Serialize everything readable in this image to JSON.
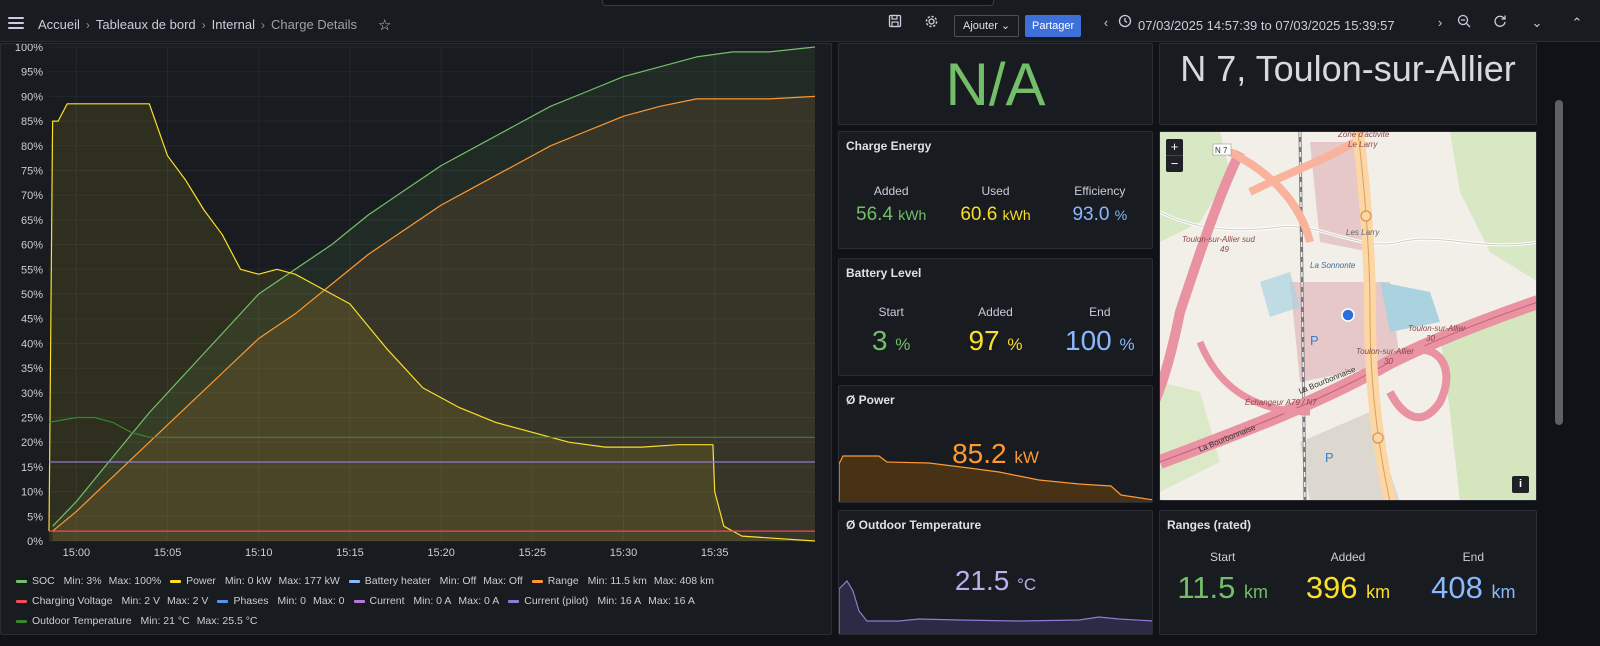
{
  "topbar": {
    "breadcrumbs": [
      "Accueil",
      "Tableaux de bord",
      "Internal",
      "Charge Details"
    ],
    "add_label": "Ajouter",
    "share_label": "Partager",
    "time_range": "07/03/2025 14:57:39 to 07/03/2025 15:39:57",
    "icons": [
      "menu-icon",
      "star-icon",
      "save-icon",
      "gear-icon",
      "chevron-down-icon",
      "chevron-left-icon",
      "clock-icon",
      "chevron-right-icon",
      "zoom-out-icon",
      "refresh-icon",
      "chevron-up-icon"
    ]
  },
  "status_panel": {
    "value": "N/A"
  },
  "address_panel": {
    "value": "N 7, Toulon-sur-Allier"
  },
  "charge_energy": {
    "title": "Charge Energy",
    "items": [
      {
        "label": "Added",
        "value": "56.4",
        "unit": "kWh"
      },
      {
        "label": "Used",
        "value": "60.6",
        "unit": "kWh"
      },
      {
        "label": "Efficiency",
        "value": "93.0",
        "unit": "%"
      }
    ]
  },
  "battery_level": {
    "title": "Battery Level",
    "items": [
      {
        "label": "Start",
        "value": "3",
        "unit": "%"
      },
      {
        "label": "Added",
        "value": "97",
        "unit": "%"
      },
      {
        "label": "End",
        "value": "100",
        "unit": "%"
      }
    ]
  },
  "avg_power": {
    "title": "Ø Power",
    "value": "85.2",
    "unit": "kW"
  },
  "avg_temp": {
    "title": "Ø Outdoor Temperature",
    "value": "21.5",
    "unit": "°C"
  },
  "ranges": {
    "title": "Ranges (rated)",
    "items": [
      {
        "label": "Start",
        "value": "11.5",
        "unit": "km"
      },
      {
        "label": "Added",
        "value": "396",
        "unit": "km"
      },
      {
        "label": "End",
        "value": "408",
        "unit": "km"
      }
    ]
  },
  "map": {
    "zoom_in": "+",
    "zoom_out": "−",
    "info": "i",
    "labels": [
      "N 7",
      "Zone d'activité\nLe Larry",
      "Les Larry",
      "Toulon-sur-Allier sud",
      "49",
      "La Sonnonte",
      "Toulon-sur-Allier",
      "30",
      "Échangeur A79 / N7",
      "La Bourbonnaise",
      "P"
    ],
    "colors": {
      "land": "#f2efe9",
      "urban": "#e6c8c8",
      "motorway": "#e892a2",
      "trunk": "#f9b29c",
      "primary": "#fcd6a4",
      "water": "#aad3df",
      "green": "#cde4b4",
      "marker": "#2a6fe0"
    }
  },
  "legend": [
    {
      "name": "SOC",
      "min": "Min: 3%",
      "max": "Max: 100%",
      "color": "#73bf69"
    },
    {
      "name": "Power",
      "min": "Min: 0 kW",
      "max": "Max: 177 kW",
      "color": "#fade2a"
    },
    {
      "name": "Battery heater",
      "min": "Min: Off",
      "max": "Max: Off",
      "color": "#8ab8ff"
    },
    {
      "name": "Range",
      "min": "Min: 11.5 km",
      "max": "Max: 408 km",
      "color": "#ff9830"
    },
    {
      "name": "Charging Voltage",
      "min": "Min: 2 V",
      "max": "Max: 2 V",
      "color": "#f2495c"
    },
    {
      "name": "Phases",
      "min": "Min: 0",
      "max": "Max: 0",
      "color": "#5794f2"
    },
    {
      "name": "Current",
      "min": "Min: 0 A",
      "max": "Max: 0 A",
      "color": "#b877d9"
    },
    {
      "name": "Current (pilot)",
      "min": "Min: 16 A",
      "max": "Max: 16 A",
      "color": "#8f7ad4"
    },
    {
      "name": "Outdoor Temperature",
      "min": "Min: 21 °C",
      "max": "Max: 25.5 °C",
      "color": "#37872d"
    }
  ],
  "chart_data": {
    "type": "line",
    "ylim": [
      0,
      100
    ],
    "y_ticks": [
      "0%",
      "5%",
      "10%",
      "15%",
      "20%",
      "25%",
      "30%",
      "35%",
      "40%",
      "45%",
      "50%",
      "55%",
      "60%",
      "65%",
      "70%",
      "75%",
      "80%",
      "85%",
      "90%",
      "95%",
      "100%"
    ],
    "x_ticks": [
      "15:00",
      "15:05",
      "15:10",
      "15:15",
      "15:20",
      "15:25",
      "15:30",
      "15:35"
    ],
    "x_range_min": [
      -1.5,
      40.5
    ],
    "grid": true,
    "series": [
      {
        "name": "SOC",
        "color": "#73bf69",
        "t": [
          -1.3,
          0,
          2,
          4,
          6,
          8,
          10,
          12,
          14,
          16,
          18,
          20,
          22,
          24,
          26,
          28,
          30,
          32,
          34,
          36,
          38,
          40.5
        ],
        "v": [
          3,
          8,
          17,
          26,
          34,
          42,
          50,
          55,
          60,
          66,
          71,
          76,
          80,
          84,
          88,
          91,
          94,
          96,
          98,
          99,
          99,
          100
        ]
      },
      {
        "name": "Power",
        "color": "#fade2a",
        "t": [
          -1.5,
          -1.3,
          -1.0,
          -0.5,
          0.5,
          2,
          3,
          4,
          5,
          6,
          7,
          8,
          9,
          10,
          11,
          12,
          13,
          14,
          15,
          17,
          19,
          21,
          23,
          25,
          27,
          29,
          31,
          33,
          34,
          34.9,
          35,
          35.5,
          36.5,
          40.5
        ],
        "v": [
          2,
          85,
          85,
          88.5,
          88.5,
          88.5,
          88.5,
          88.5,
          78,
          73,
          67,
          62,
          55,
          54,
          55,
          54,
          52,
          50,
          48,
          39,
          31,
          27,
          24,
          22,
          20,
          19,
          19,
          19.5,
          19.5,
          19.5,
          10,
          3,
          1,
          0
        ]
      },
      {
        "name": "Range",
        "color": "#ff9830",
        "t": [
          -1.3,
          0,
          2,
          4,
          6,
          8,
          10,
          12,
          14,
          16,
          18,
          20,
          22,
          24,
          26,
          28,
          30,
          32,
          34,
          36,
          38,
          40.5
        ],
        "v": [
          2,
          6,
          13,
          20,
          27,
          34,
          41,
          46,
          52,
          58,
          63,
          68,
          72,
          76,
          80,
          83,
          86,
          88,
          89.5,
          89.5,
          89.5,
          90
        ]
      },
      {
        "name": "Outdoor Temperature",
        "color": "#37872d",
        "t": [
          -1.5,
          0,
          1,
          2,
          3,
          4,
          6,
          10,
          20,
          30,
          35,
          40.5
        ],
        "v": [
          24,
          25,
          25,
          24,
          22,
          21,
          21,
          21,
          21,
          21,
          21,
          21
        ]
      },
      {
        "name": "Current (pilot)",
        "color": "#8f7ad4",
        "t": [
          -1.5,
          40.5
        ],
        "v": [
          16,
          16
        ]
      },
      {
        "name": "Charging Voltage",
        "color": "#f2495c",
        "t": [
          -1.5,
          40.5
        ],
        "v": [
          2,
          2
        ]
      }
    ]
  }
}
